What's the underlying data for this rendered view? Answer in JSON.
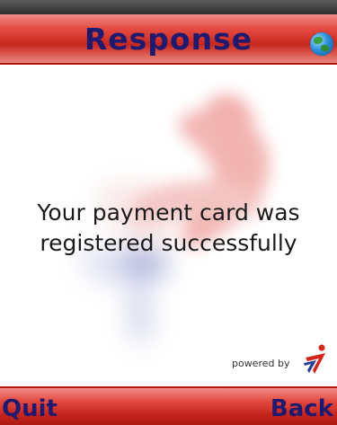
{
  "header": {
    "title": "Response",
    "icon": "globe-icon"
  },
  "message": {
    "line1": "Your payment card was",
    "line2": "registered successfully"
  },
  "branding": {
    "powered_by": "powered by",
    "logo": "brand-logo"
  },
  "softkeys": {
    "left": "Quit",
    "right": "Back"
  },
  "colors": {
    "bar_red": "#e44b42",
    "title_text": "#1f1a6e",
    "watermark_red": "#e98a86",
    "watermark_blue": "#8790c8"
  }
}
